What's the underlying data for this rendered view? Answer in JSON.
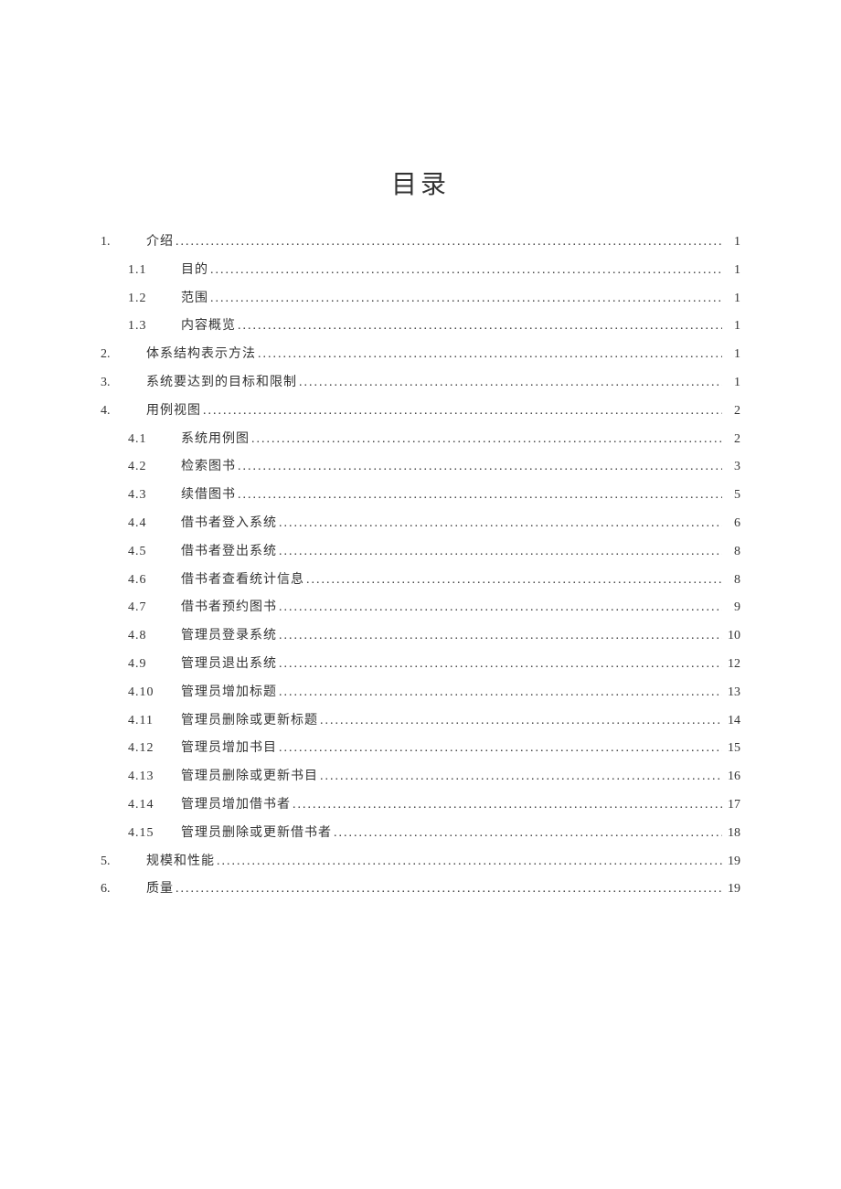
{
  "title": "目录",
  "entries": [
    {
      "level": 1,
      "num": "1.",
      "title": "介绍",
      "page": "1"
    },
    {
      "level": 2,
      "num": "1.1",
      "title": "目的",
      "page": "1"
    },
    {
      "level": 2,
      "num": "1.2",
      "title": "范围",
      "page": "1"
    },
    {
      "level": 2,
      "num": "1.3",
      "title": "内容概览",
      "page": "1"
    },
    {
      "level": 1,
      "num": "2.",
      "title": "体系结构表示方法",
      "page": "1"
    },
    {
      "level": 1,
      "num": "3.",
      "title": "系统要达到的目标和限制",
      "page": "1"
    },
    {
      "level": 1,
      "num": "4.",
      "title": "用例视图",
      "page": "2"
    },
    {
      "level": 2,
      "num": "4.1",
      "title": "系统用例图",
      "page": "2"
    },
    {
      "level": 2,
      "num": "4.2",
      "title": "检索图书",
      "page": "3"
    },
    {
      "level": 2,
      "num": "4.3",
      "title": "续借图书",
      "page": "5"
    },
    {
      "level": 2,
      "num": "4.4",
      "title": "借书者登入系统",
      "page": "6"
    },
    {
      "level": 2,
      "num": "4.5",
      "title": "借书者登出系统",
      "page": "8"
    },
    {
      "level": 2,
      "num": "4.6",
      "title": "借书者查看统计信息",
      "page": "8"
    },
    {
      "level": 2,
      "num": "4.7",
      "title": "借书者预约图书",
      "page": "9"
    },
    {
      "level": 2,
      "num": "4.8",
      "title": "管理员登录系统",
      "page": "10"
    },
    {
      "level": 2,
      "num": "4.9",
      "title": "管理员退出系统",
      "page": "12"
    },
    {
      "level": 2,
      "num": "4.10",
      "title": "管理员增加标题",
      "page": "13"
    },
    {
      "level": 2,
      "num": "4.11",
      "title": "管理员删除或更新标题",
      "page": "14"
    },
    {
      "level": 2,
      "num": "4.12",
      "title": "管理员增加书目",
      "page": "15"
    },
    {
      "level": 2,
      "num": "4.13",
      "title": "管理员删除或更新书目",
      "page": "16"
    },
    {
      "level": 2,
      "num": "4.14",
      "title": "管理员增加借书者",
      "page": "17"
    },
    {
      "level": 2,
      "num": "4.15",
      "title": "管理员删除或更新借书者",
      "page": "18"
    },
    {
      "level": 1,
      "num": "5.",
      "title": "规模和性能",
      "page": "19"
    },
    {
      "level": 1,
      "num": "6.",
      "title": "质量",
      "page": "19"
    }
  ]
}
